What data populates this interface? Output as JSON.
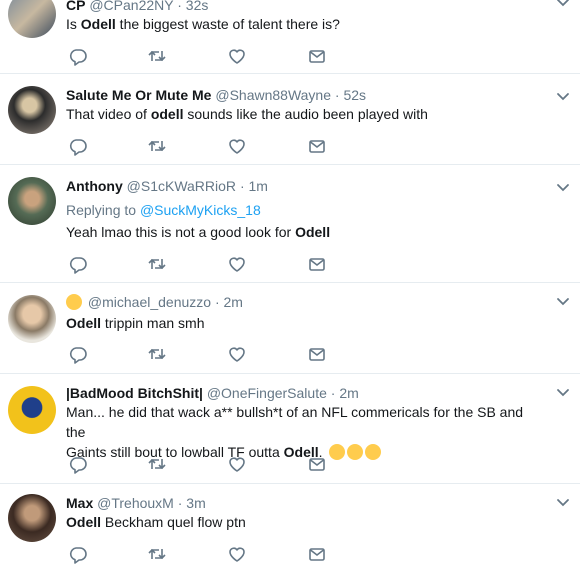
{
  "tweets": [
    {
      "fullname": "CP",
      "handle": "@CPan22NY",
      "time": "· 32s",
      "text_pre": "Is ",
      "text_bold": "Odell",
      "text_post": " the biggest waste of talent there is?"
    },
    {
      "fullname": "Salute Me Or Mute Me",
      "handle": "@Shawn88Wayne",
      "time": "· 52s",
      "text_pre": "That video of ",
      "text_bold": "odell",
      "text_post": " sounds like the audio been played with"
    },
    {
      "fullname": "Anthony",
      "handle": "@S1cKWaRRioR",
      "time": "· 1m",
      "reply_prefix": "Replying to ",
      "reply_to": "@SuckMyKicks_18",
      "text_pre": "Yeah lmao this is not a good look for ",
      "text_bold": "Odell",
      "text_post": ""
    },
    {
      "fullname": "",
      "handle": "@michael_denuzzo",
      "time": "· 2m",
      "text_pre": "",
      "text_bold": "Odell",
      "text_post": " trippin man smh"
    },
    {
      "fullname": "|BadMood BitchShit|",
      "handle": "@OneFingerSalute",
      "time": "· 2m",
      "text_line1": "Man... he did that wack a** bullsh*t of an NFL commericals for the SB and the",
      "text_line2_pre": "Gaints still bout to lowball TF outta ",
      "text_bold": "Odell",
      "text_post": "."
    },
    {
      "fullname": "Max",
      "handle": "@TrehouxM",
      "time": "· 3m",
      "text_pre": "",
      "text_bold": "Odell",
      "text_post": " Beckham quel flow ptn"
    }
  ],
  "icons": {
    "reply": "reply-icon",
    "retweet": "retweet-icon",
    "like": "like-icon",
    "dm": "direct-message-icon",
    "more": "chevron-down-icon"
  },
  "colors": {
    "action_icon": "#657786",
    "link": "#1da1f2",
    "border": "#e6ecf0"
  }
}
